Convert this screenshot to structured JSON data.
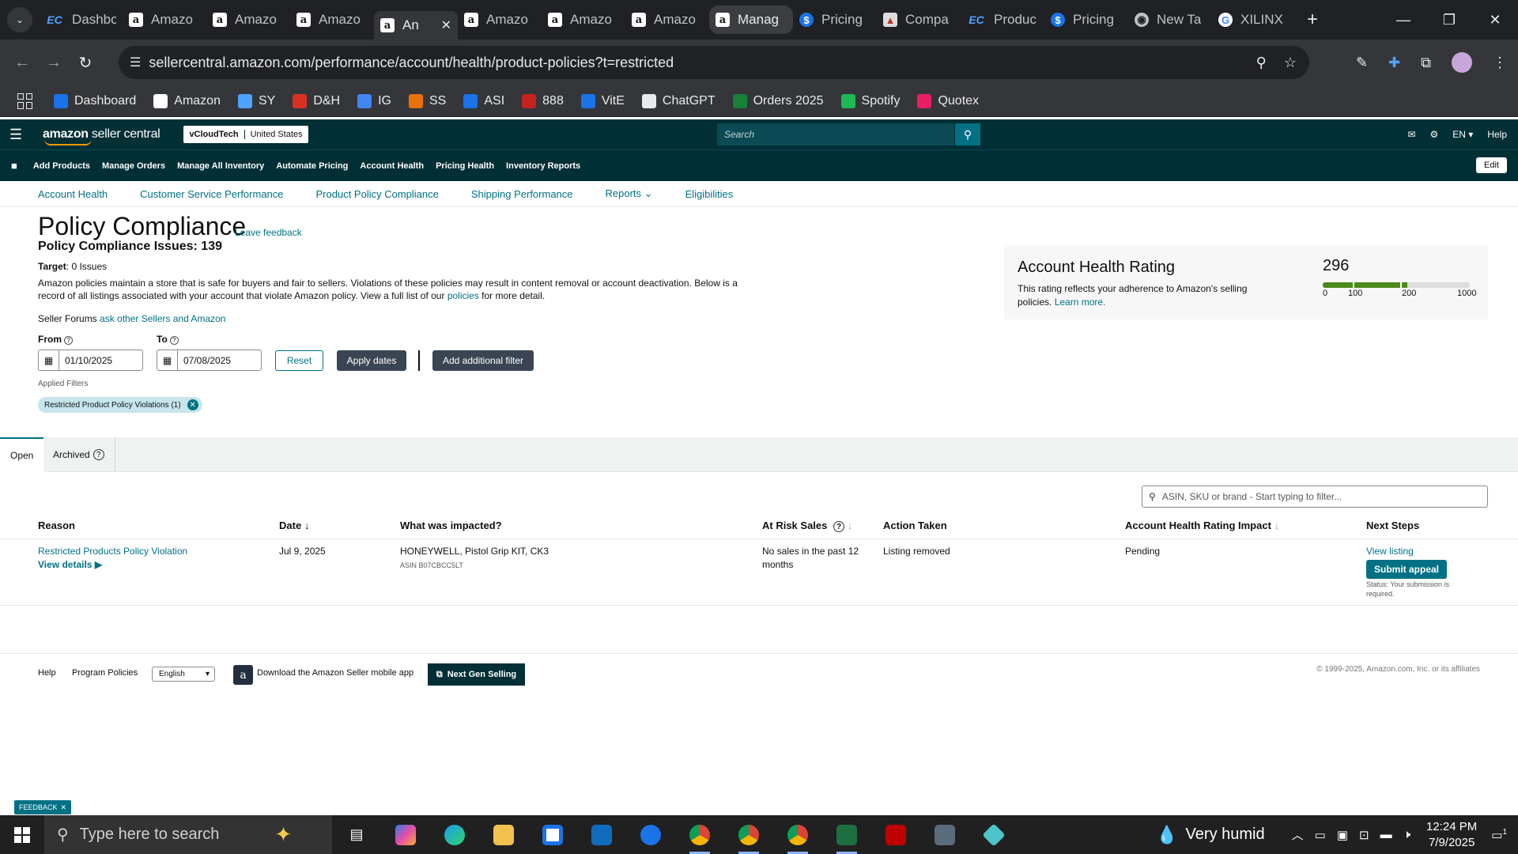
{
  "browser": {
    "tabs": [
      {
        "label": "Dashbo",
        "icon": "ec"
      },
      {
        "label": "Amazo",
        "icon": "amz"
      },
      {
        "label": "Amazo",
        "icon": "amz"
      },
      {
        "label": "Amazo",
        "icon": "amz"
      },
      {
        "label": "An",
        "icon": "amz",
        "active": true
      },
      {
        "label": "Amazo",
        "icon": "amz"
      },
      {
        "label": "Amazo",
        "icon": "amz"
      },
      {
        "label": "Amazo",
        "icon": "amz"
      },
      {
        "label": "Manag",
        "icon": "amz",
        "highlighted": true
      },
      {
        "label": "Pricing",
        "icon": "blue"
      },
      {
        "label": "Compa",
        "icon": "comp"
      },
      {
        "label": "Produc",
        "icon": "ec"
      },
      {
        "label": "Pricing",
        "icon": "blue"
      },
      {
        "label": "New Ta",
        "icon": "chrome"
      },
      {
        "label": "XILINX",
        "icon": "g"
      }
    ],
    "url": "sellercentral.amazon.com/performance/account/health/product-policies?t=restricted",
    "bookmarks": [
      {
        "label": "Dashboard",
        "color": "#1a73e8"
      },
      {
        "label": "Amazon",
        "color": "#ffffff"
      },
      {
        "label": "SY",
        "color": "#4da3ff"
      },
      {
        "label": "D&H",
        "color": "#d93025"
      },
      {
        "label": "IG",
        "color": "#4285f4"
      },
      {
        "label": "SS",
        "color": "#e8710a"
      },
      {
        "label": "ASI",
        "color": "#1a73e8"
      },
      {
        "label": "888",
        "color": "#c5221f"
      },
      {
        "label": "VitE",
        "color": "#1a73e8"
      },
      {
        "label": "ChatGPT",
        "color": "#e8eaed"
      },
      {
        "label": "Orders 2025",
        "color": "#188038"
      },
      {
        "label": "Spotify",
        "color": "#1db954"
      },
      {
        "label": "Quotex",
        "color": "#e91e63"
      }
    ]
  },
  "seller_central": {
    "logo_bold": "amazon",
    "logo_rest": " seller central",
    "account_name": "vCloudTech",
    "marketplace": "United States",
    "search_placeholder": "Search",
    "language": "EN",
    "help": "Help",
    "nav_links": [
      "Add Products",
      "Manage Orders",
      "Manage All Inventory",
      "Automate Pricing",
      "Account Health",
      "Pricing Health",
      "Inventory Reports"
    ],
    "edit_label": "Edit",
    "sub_nav": [
      "Account Health",
      "Customer Service Performance",
      "Product Policy Compliance",
      "Shipping Performance",
      "Reports",
      "Eligibilities"
    ]
  },
  "page": {
    "title": "Policy Compliance",
    "leave_feedback": "Leave feedback",
    "issues_label": "Policy Compliance Issues: 139",
    "target_label": "Target",
    "target_value": ": 0 Issues",
    "description_main": "Amazon policies maintain a store that is safe for buyers and fair to sellers. Violations of these policies may result in content removal or account deactivation. Below is a record of all listings associated with your account that violate Amazon policy. View a full list of our ",
    "description_link": "policies",
    "description_end": " for more detail.",
    "forums_label": "Seller Forums ",
    "forums_link": "ask other Sellers and Amazon",
    "from_label": "From",
    "to_label": "To",
    "from_date": "01/10/2025",
    "to_date": "07/08/2025",
    "reset_label": "Reset",
    "apply_label": "Apply dates",
    "add_filter_label": "Add additional filter",
    "applied_filters_label": "Applied Filters",
    "chip_label": "Restricted Product Policy Violations (1)"
  },
  "ahr": {
    "title": "Account Health Rating",
    "desc": "This rating reflects your adherence to Amazon's selling policies. ",
    "learn_more": "Learn more.",
    "score": "296",
    "ticks": [
      "0",
      "100",
      "200",
      "1000"
    ]
  },
  "tabs": {
    "open": "Open",
    "archived": "Archived"
  },
  "filter_placeholder": "ASIN, SKU or brand - Start typing to filter...",
  "table": {
    "headers": [
      "Reason",
      "Date",
      "What was impacted?",
      "At Risk Sales",
      "Action Taken",
      "Account Health Rating Impact",
      "Next Steps"
    ],
    "row": {
      "reason": "Restricted Products Policy Violation",
      "view_details": "View details",
      "date": "Jul 9, 2025",
      "impacted": "HONEYWELL, Pistol Grip KIT, CK3",
      "asin": "ASIN B07CBCC5LT",
      "at_risk": "No sales in the past 12 months",
      "action": "Listing removed",
      "impact": "Pending",
      "view_listing": "View listing",
      "appeal": "Submit appeal",
      "status": "Status: Your submission is required."
    }
  },
  "footer": {
    "help": "Help",
    "program_policies": "Program Policies",
    "language": "English",
    "app_text": "Download the Amazon Seller mobile app",
    "next_gen": "Next Gen Selling",
    "copyright": "© 1999-2025, Amazon.com, Inc. or its affiliates"
  },
  "feedback_tab": "FEEDBACK",
  "taskbar": {
    "search_placeholder": "Type here to search",
    "weather": "Very humid",
    "time": "12:24 PM",
    "date": "7/9/2025",
    "notifications": "1"
  }
}
